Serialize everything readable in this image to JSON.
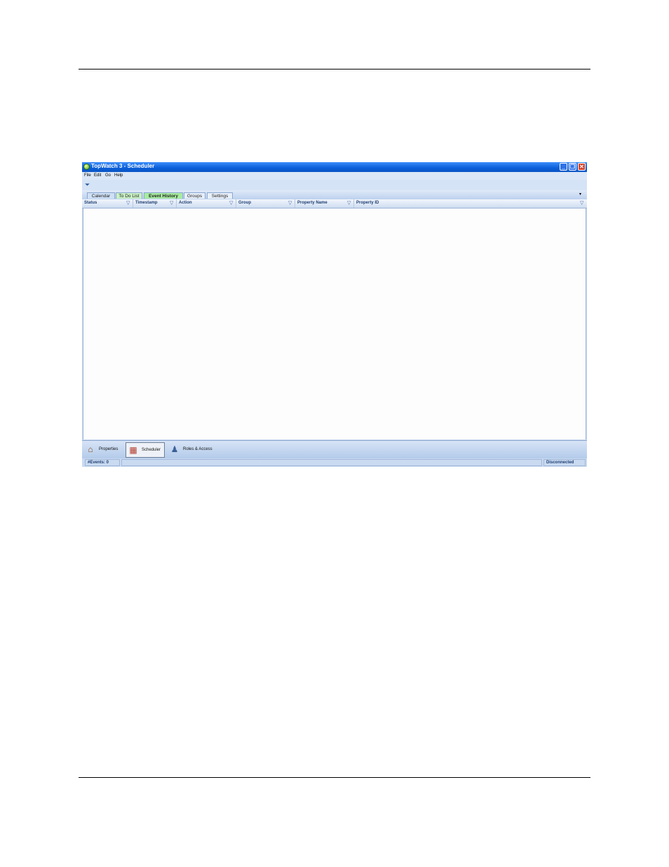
{
  "window": {
    "title": "TopWatch 3 - Scheduler"
  },
  "menu": {
    "file": "File",
    "edit": "Edit",
    "go": "Go",
    "help": "Help"
  },
  "toolbar": {
    "filter_icon": "filter-icon"
  },
  "tabs": [
    {
      "label": "Calendar"
    },
    {
      "label": "To Do List"
    },
    {
      "label": "Event History",
      "selected": true
    },
    {
      "label": "Groups"
    },
    {
      "label": "Settings"
    }
  ],
  "grid": {
    "columns": [
      {
        "label": "Status"
      },
      {
        "label": "Timestamp"
      },
      {
        "label": "Action"
      },
      {
        "label": "Group"
      },
      {
        "label": "Property Name"
      },
      {
        "label": "Property ID"
      }
    ],
    "rows": []
  },
  "nav": {
    "properties": "Properties",
    "scheduler": "Scheduler",
    "roles": "Roles & Access"
  },
  "status": {
    "events": "#Events: 0",
    "connection": "Disconnected"
  },
  "colors": {
    "titlebar": "#0a5ed8",
    "selected_tab": "#a7ec9f",
    "panel": "#c7d9f2"
  }
}
